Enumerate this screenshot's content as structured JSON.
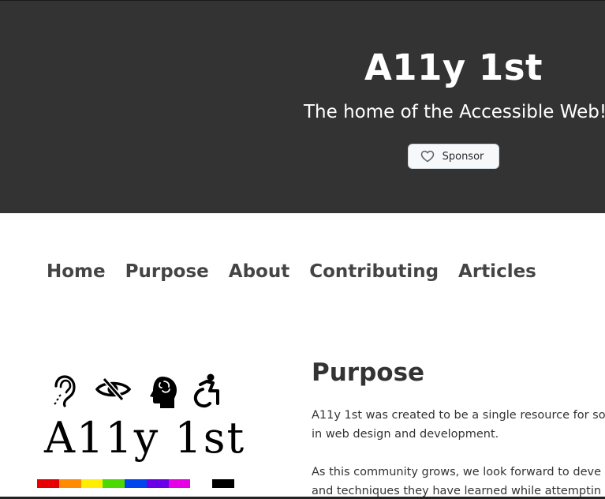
{
  "header": {
    "title": "A11y 1st",
    "tagline": "The home of the Accessible Web!",
    "sponsor_label": "Sponsor",
    "sponsor_icon": "heart-icon",
    "background_color": "#333333"
  },
  "nav": {
    "items": [
      {
        "label": "Home"
      },
      {
        "label": "Purpose"
      },
      {
        "label": "About"
      },
      {
        "label": "Contributing"
      },
      {
        "label": "Articles"
      }
    ]
  },
  "logo": {
    "text": "A11y 1st",
    "icons": [
      "hearing-impaired-icon",
      "vision-impaired-icon",
      "cognitive-icon",
      "wheelchair-icon"
    ],
    "rainbow_colors": [
      "#e60000",
      "#ff8c00",
      "#ffee00",
      "#4cd900",
      "#0044ee",
      "#6a00e6",
      "#e600e6",
      "#ffffff",
      "#000000"
    ]
  },
  "content": {
    "title": "Purpose",
    "paragraphs": [
      {
        "line1": "A11y 1st was created to be a single resource for so",
        "line2": "in web design and development."
      },
      {
        "line1": "As this community grows, we look forward to deve",
        "line2": "and techniques they have learned while attemptin"
      }
    ]
  }
}
